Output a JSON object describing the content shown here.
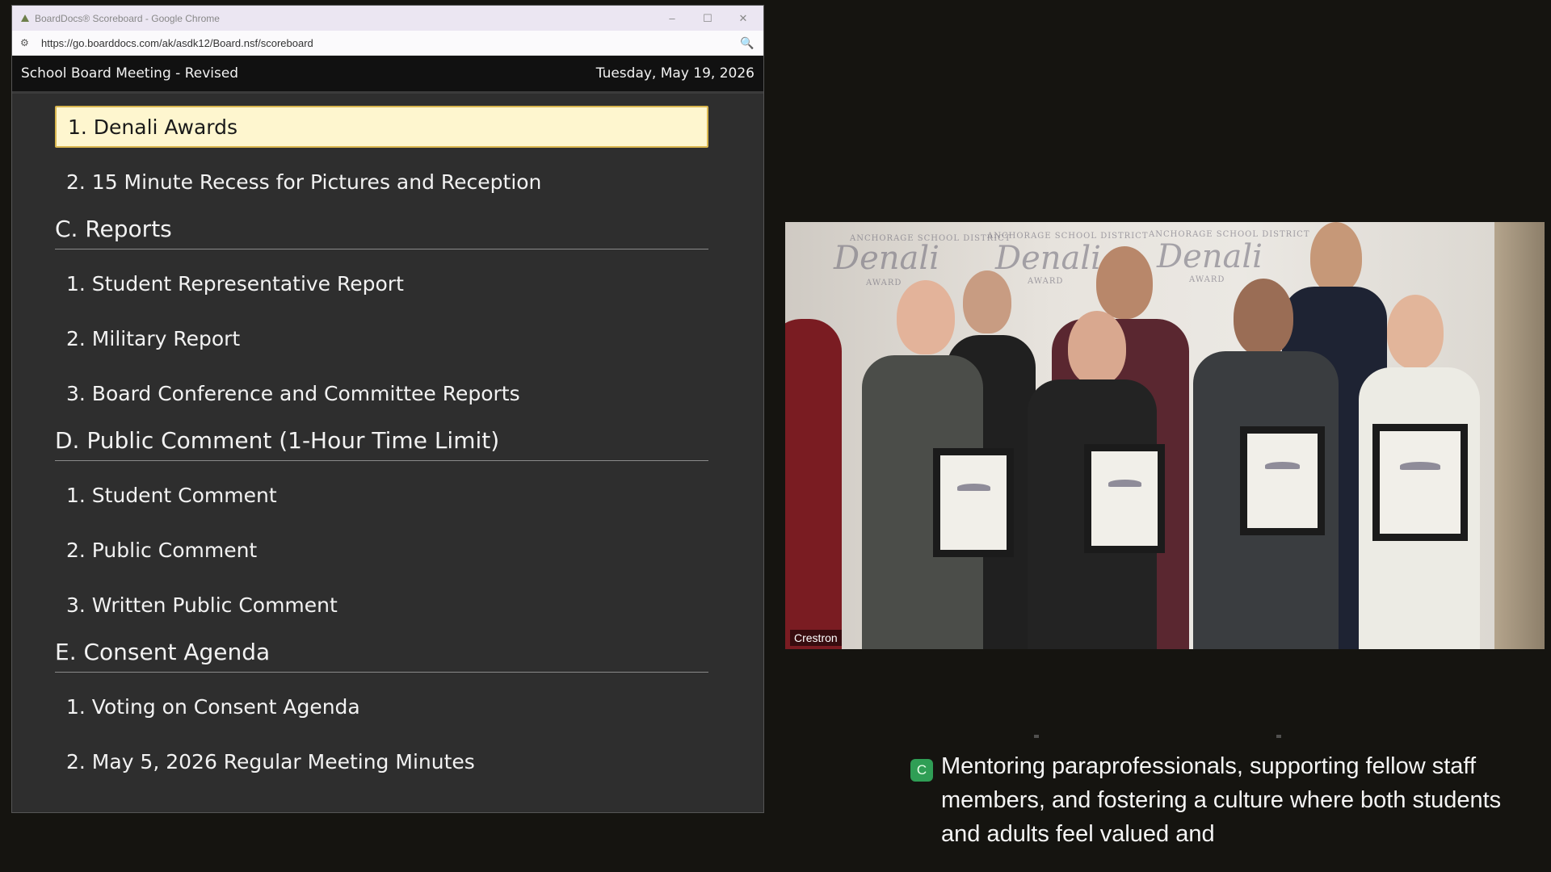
{
  "browser": {
    "title": "BoardDocs® Scoreboard - Google Chrome",
    "url": "https://go.boarddocs.com/ak/asdk12/Board.nsf/scoreboard",
    "controls": {
      "minimize": "–",
      "maximize": "☐",
      "close": "✕"
    },
    "icons": {
      "site_info": "tune-icon",
      "zoom": "zoom-icon"
    }
  },
  "meeting": {
    "title": "School Board Meeting - Revised",
    "date": "Tuesday, May 19, 2026"
  },
  "agenda": {
    "items_top": [
      {
        "label": "1. Denali Awards",
        "active": true
      },
      {
        "label": "2. 15 Minute Recess for Pictures and Reception",
        "active": false
      }
    ],
    "section_c": {
      "title": "C. Reports",
      "items": [
        "1. Student Representative Report",
        "2. Military Report",
        "3. Board Conference and Committee Reports"
      ]
    },
    "section_d": {
      "title": "D. Public Comment (1-Hour Time Limit)",
      "items": [
        "1. Student Comment",
        "2. Public Comment",
        "3. Written Public Comment"
      ]
    },
    "section_e": {
      "title": "E. Consent Agenda",
      "items": [
        "1. Voting on Consent Agenda",
        "2. May 5, 2026 Regular Meeting Minutes"
      ]
    }
  },
  "video": {
    "label": "Crestron",
    "backdrop_logo": "Denali",
    "backdrop_org": "ANCHORAGE SCHOOL DISTRICT",
    "backdrop_award": "AWARD"
  },
  "caption": {
    "badge": "C",
    "text": "Mentoring paraprofessionals, supporting fellow staff members, and fostering a culture where both students and adults feel valued and"
  },
  "colors": {
    "active_item_bg": "#fef6cf",
    "caption_badge": "#2f9e55",
    "panel_bg": "#2e2e2e"
  }
}
